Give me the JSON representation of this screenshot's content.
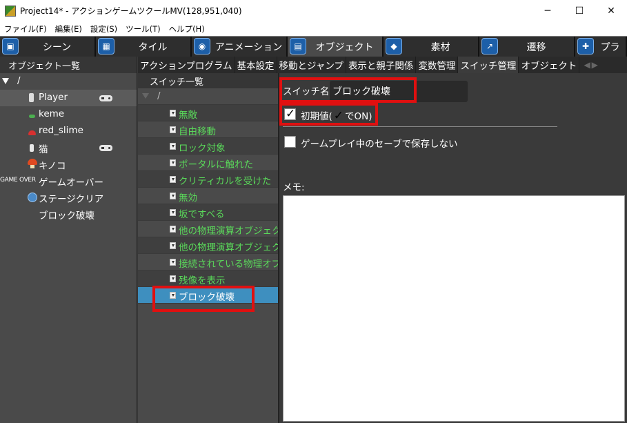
{
  "window": {
    "title": "Project14* - アクションゲームツクールMV(128,951,040)",
    "minimize_glyph": "─",
    "maximize_glyph": "☐",
    "close_glyph": "✕"
  },
  "menubar": [
    "ファイル(F)",
    "編集(E)",
    "設定(S)",
    "ツール(T)",
    "ヘルプ(H)"
  ],
  "main_tabs": [
    {
      "label": "シーン",
      "icon": "scene-icon",
      "glyph": "▣"
    },
    {
      "label": "タイル",
      "icon": "tile-icon",
      "glyph": "▦"
    },
    {
      "label": "アニメーション",
      "icon": "animation-icon",
      "glyph": "◉"
    },
    {
      "label": "オブジェクト",
      "icon": "object-icon",
      "glyph": "▤",
      "active": true
    },
    {
      "label": "素材",
      "icon": "material-icon",
      "glyph": "◆"
    },
    {
      "label": "遷移",
      "icon": "transition-icon",
      "glyph": "↗"
    },
    {
      "label": "プラ",
      "icon": "plugin-icon",
      "glyph": "✚"
    }
  ],
  "object_list": {
    "header": "オブジェクト一覧",
    "root": "/",
    "items": [
      {
        "label": "Player",
        "icon": "player-icon",
        "controller": true,
        "selected": true
      },
      {
        "label": "keme",
        "icon": "keme-icon"
      },
      {
        "label": "red_slime",
        "icon": "slime-icon"
      },
      {
        "label": "猫",
        "icon": "cat-icon",
        "controller": true
      },
      {
        "label": "キノコ",
        "icon": "mushroom-icon"
      },
      {
        "label": "ゲームオーバー",
        "prefix": "GAME OVER",
        "icon": "gameover-icon"
      },
      {
        "label": "ステージクリア",
        "icon": "stageclear-icon"
      },
      {
        "label": "ブロック破壊",
        "icon": "none"
      }
    ]
  },
  "sub_tabs": [
    "アクションプログラム",
    "基本設定",
    "移動とジャンプ",
    "表示と親子関係",
    "変数管理",
    "スイッチ管理",
    "オブジェクト"
  ],
  "sub_tab_arrows": {
    "left": "◀",
    "right": "▶"
  },
  "switch_list": {
    "header": "スイッチ一覧",
    "root": "/",
    "items": [
      "無敵",
      "自由移動",
      "ロック対象",
      "ポータルに触れた",
      "クリティカルを受けた",
      "無効",
      "坂ですべる",
      "他の物理演算オブジェク",
      "他の物理演算オブジェク",
      "接続されている物理オブ",
      "残像を表示",
      "ブロック破壊"
    ],
    "selected_index": 11
  },
  "detail": {
    "name_label": "スイッチ名:",
    "name_value": "ブロック破壊",
    "initial_label_pre": "初期値(",
    "initial_check": "✓",
    "initial_label_post": "でON)",
    "initial_checked": true,
    "nosave_label": "ゲームプレイ中のセーブで保存しない",
    "nosave_checked": false,
    "memo_label": "メモ:",
    "memo_value": ""
  },
  "colors": {
    "switch_text": "#5ad85a",
    "selection": "#3e8fbf",
    "highlight_box": "#e01010"
  }
}
